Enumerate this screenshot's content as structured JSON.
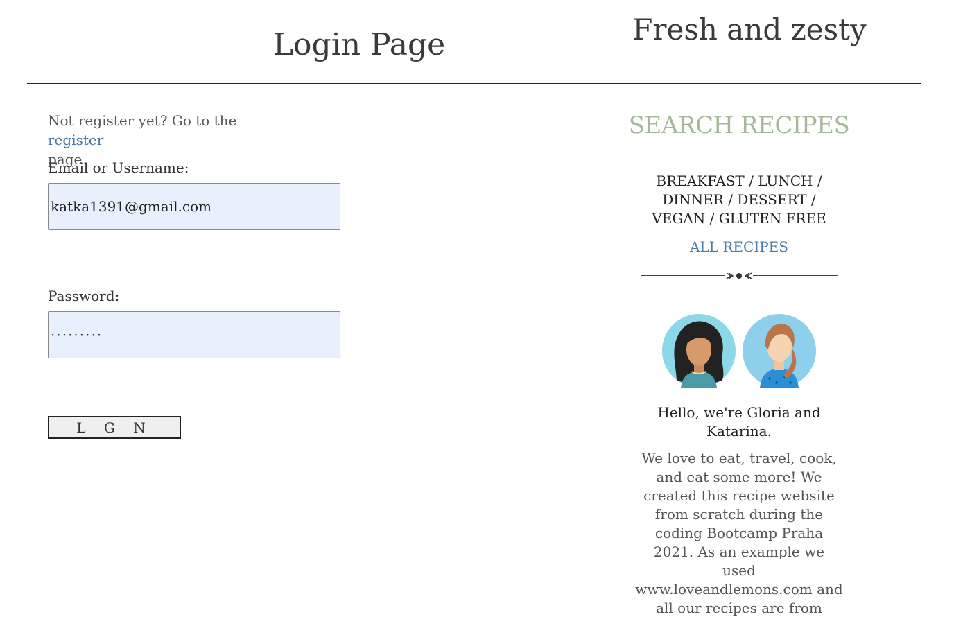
{
  "login": {
    "title": "Login Page",
    "register_prefix": "Not register yet? Go to the ",
    "register_link": "register",
    "register_suffix": "page",
    "email_label": "Email or Username:",
    "email_value": "katka1391@gmail.com",
    "password_label": "Password:",
    "password_value": "·········",
    "button_label": "L G N"
  },
  "sidebar": {
    "site_title": "Fresh and zesty",
    "search_heading": "SEARCH RECIPES",
    "categories": "BREAKFAST / LUNCH / DINNER / DESSERT / VEGAN / GLUTEN FREE",
    "all_recipes": "ALL RECIPES",
    "hello": "Hello, we're Gloria and Katarina.",
    "bio": "We love to eat, travel, cook, and eat some more! We created this recipe website from scratch during the coding Bootcamp Praha 2021. As an example we used www.loveandlemons.com and all our recipes are from www.bbcgoodfood.com."
  },
  "colors": {
    "accent_green": "#a4b99a",
    "link_blue": "#4a78a8",
    "input_bg": "#e8f0fd"
  },
  "icons": {
    "ornament": "divider-ornament-icon",
    "avatar_gloria": "woman-curly-hair-avatar-icon",
    "avatar_katarina": "woman-ponytail-avatar-icon"
  }
}
